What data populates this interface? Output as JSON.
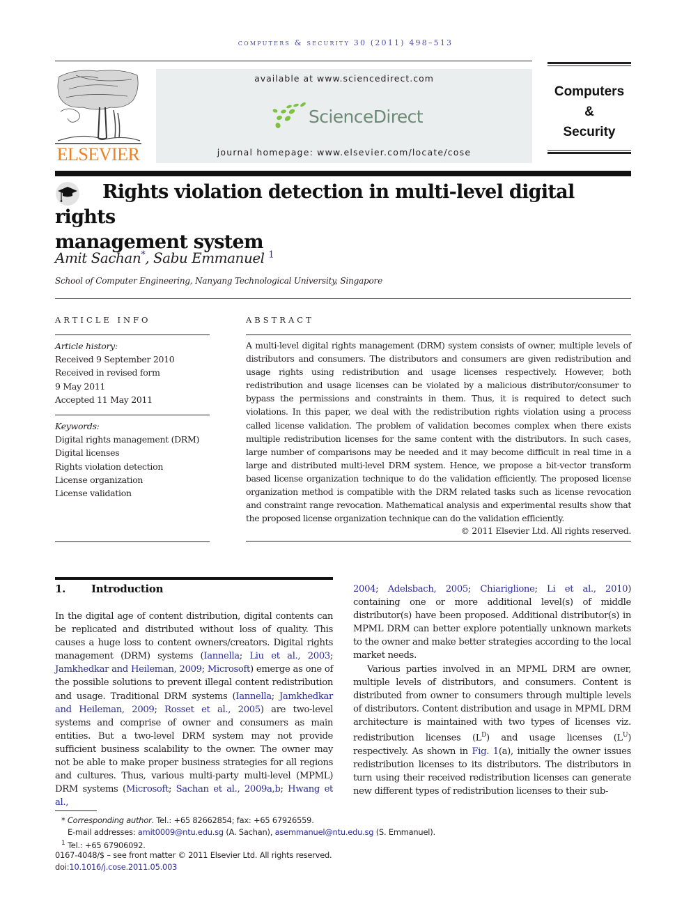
{
  "running_head": "computers & security 30 (2011) 498–513",
  "masthead": {
    "publisher": "ELSEVIER",
    "available_at": "available at www.sciencedirect.com",
    "platform": "ScienceDirect",
    "homepage": "journal homepage: www.elsevier.com/locate/cose",
    "journal_line1": "Computers",
    "journal_line2": "&",
    "journal_line3": "Security",
    "colors": {
      "elsevier_orange": "#f07f1f",
      "sd_green": "#7dc242",
      "sd_gray": "#6d8a77",
      "sd_box": "#ebeeee",
      "link_blue": "#2b2c96"
    }
  },
  "article": {
    "title_line1": "Rights violation detection in multi-level digital rights",
    "title_line2": "management system",
    "authors": [
      {
        "name": "Amit Sachan",
        "mark": "*"
      },
      {
        "name": "Sabu Emmanuel",
        "mark": "1"
      }
    ],
    "author_sep": ", ",
    "affiliation": "School of Computer Engineering, Nanyang Technological University, Singapore"
  },
  "article_info": {
    "heading": "ARTICLE INFO",
    "history_label": "Article history:",
    "history": [
      "Received 9 September 2010",
      "Received in revised form",
      "9 May 2011",
      "Accepted 11 May 2011"
    ],
    "keywords_label": "Keywords:",
    "keywords": [
      "Digital rights management (DRM)",
      "Digital licenses",
      "Rights violation detection",
      "License organization",
      "License validation"
    ]
  },
  "abstract": {
    "heading": "ABSTRACT",
    "text": "A multi-level digital rights management (DRM) system consists of owner, multiple levels of distributors and consumers. The distributors and consumers are given redistribution and usage rights using redistribution and usage licenses respectively. However, both redistribution and usage licenses can be violated by a malicious distributor/consumer to bypass the permissions and constraints in them. Thus, it is required to detect such violations. In this paper, we deal with the redistribution rights violation using a process called license validation. The problem of validation becomes complex when there exists multiple redistribution licenses for the same content with the distributors. In such cases, large number of comparisons may be needed and it may become difficult in real time in a large and distributed multi-level DRM system. Hence, we propose a bit-vector transform based license organization technique to do the validation efficiently. The proposed license organization method is compatible with the DRM related tasks such as license revocation and constraint range revocation. Mathematical analysis and experimental results show that the proposed license organization technique can do the validation efficiently.",
    "copyright": "© 2011 Elsevier Ltd. All rights reserved."
  },
  "introduction": {
    "number": "1.",
    "heading": "Introduction",
    "left": {
      "t1": "In the digital age of content distribution, digital contents can be replicated and distributed without loss of quality. This causes a huge loss to content owners/creators. Digital rights management (DRM) systems (",
      "c1": "Iannella",
      "s1": "; ",
      "c2": "Liu et al., 2003",
      "s2": "; ",
      "c3": "Jamkhedkar and Heileman, 2009",
      "s3": "; ",
      "c4": "Microsoft",
      "t2": ") emerge as one of the possible solutions to prevent illegal content redistribution and usage. Traditional DRM systems (",
      "c5": "Iannella",
      "s4": "; ",
      "c6": "Jamkhedkar and Heileman, 2009",
      "s5": "; ",
      "c7": "Rosset et al., 2005",
      "t3": ") are two-level systems and comprise of owner and consumers as main entities. But a two-level DRM system may not provide sufficient business scalability to the owner. The owner may not be able to make proper business strategies for all regions and cultures. Thus, various multi-party multi-level (MPML) DRM systems (",
      "c8": "Microsoft",
      "s6": "; ",
      "c9": "Sachan et al., 2009a,b",
      "s7": "; ",
      "c10": "Hwang et al.,"
    },
    "right": {
      "c1": "2004",
      "s1": "; ",
      "c2": "Adelsbach, 2005",
      "s2": "; ",
      "c3": "Chiariglione",
      "s3": "; ",
      "c4": "Li et al., 2010",
      "t1": ") containing one or more additional level(s) of middle distributor(s) have been proposed. Additional distributor(s) in MPML DRM can better explore potentially unknown markets to the owner and make better strategies according to the local market needs.",
      "t2": "Various parties involved in an MPML DRM are owner, multiple levels of distributors, and consumers. Content is distributed from owner to consumers through multiple levels of distributors. Content distribution and usage in MPML DRM architecture is maintained with two types of licenses viz. redistribution licenses (L",
      "sup1": "D",
      "t3": ") and usage licenses (L",
      "sup2": "U",
      "t4": ") respectively. As shown in ",
      "c5": "Fig. 1",
      "t5": "(a), initially the owner issues redistribution licenses to its distributors. The distributors in turn using their received redistribution licenses can generate new different types of redistribution licenses to their sub-"
    }
  },
  "footnotes": {
    "corr_mark": "*",
    "corr_label": "Corresponding author",
    "corr_text": ". Tel.: +65 82662854; fax: +65 67926559.",
    "email_label": "E-mail addresses: ",
    "email1": "amit0009@ntu.edu.sg",
    "email1_who": " (A. Sachan), ",
    "email2": "asemmanuel@ntu.edu.sg",
    "email2_who": " (S. Emmanuel).",
    "fn1_mark": "1",
    "fn1_text": " Tel.: +65 67906092.",
    "front_matter": "0167-4048/$ – see front matter © 2011 Elsevier Ltd. All rights reserved.",
    "doi_label": "doi:",
    "doi": "10.1016/j.cose.2011.05.003"
  }
}
